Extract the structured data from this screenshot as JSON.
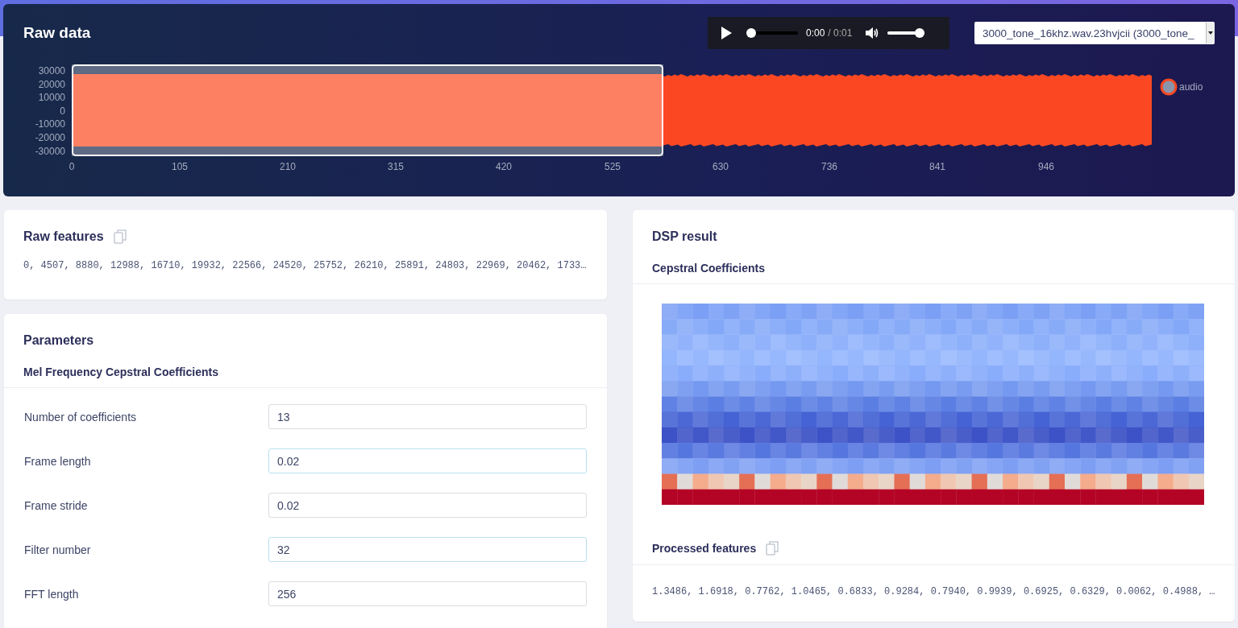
{
  "raw_data": {
    "title": "Raw data",
    "player": {
      "playing": false,
      "progress": {
        "level": 0
      },
      "current_time": "0:00",
      "duration": "/ 0:01",
      "volume": {
        "level": 1
      }
    },
    "sample_select": {
      "value": "3000_tone_16khz.wav.23hvjcii (3000_tone_"
    },
    "y_axis_labels": [
      "30000",
      "20000",
      "10000",
      "0",
      "-10000",
      "-20000",
      "-30000"
    ],
    "x_axis_labels": [
      "0",
      "105",
      "210",
      "315",
      "420",
      "525",
      "630",
      "736",
      "841",
      "946"
    ],
    "legend": {
      "label": "audio"
    }
  },
  "raw_features": {
    "title": "Raw features",
    "values": "0, 4507, 8880, 12988, 16710, 19932, 22566, 24520, 25752, 26210, 25891, 24803, 22969, 20462, 1733…"
  },
  "parameters": {
    "title": "Parameters",
    "section": "Mel Frequency Cepstral Coefficients",
    "fields": [
      {
        "label": "Number of coefficients",
        "value": "13",
        "highlighted": false
      },
      {
        "label": "Frame length",
        "value": "0.02",
        "highlighted": true
      },
      {
        "label": "Frame stride",
        "value": "0.02",
        "highlighted": false
      },
      {
        "label": "Filter number",
        "value": "32",
        "highlighted": true
      },
      {
        "label": "FFT length",
        "value": "256",
        "highlighted": false
      }
    ]
  },
  "dsp_result": {
    "title": "DSP result",
    "section": "Cepstral Coefficients",
    "processed_features": {
      "title": "Processed features",
      "values": "1.3486, 1.6918, 0.7762, 1.0465, 0.6833, 0.9284, 0.7940, 0.9939, 0.6925, 0.6329, 0.0062, 0.4988, …"
    }
  }
}
